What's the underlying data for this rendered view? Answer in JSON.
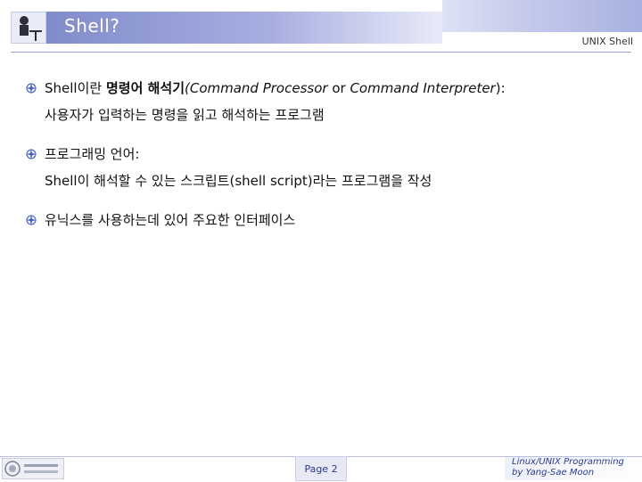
{
  "slide": {
    "title": "Shell?",
    "header_label": "UNIX Shell"
  },
  "bullets": [
    {
      "line1_a": "Shell이란 ",
      "line1_b": "명령어 해석기",
      "line1_c": "(Command Processor ",
      "line1_d": "or ",
      "line1_e": "Command Interpreter",
      "line1_f": "):",
      "line2": "사용자가 입력하는 명령을 읽고 해석하는 프로그램"
    },
    {
      "line1": "프로그래밍 언어:",
      "line2": "Shell이 해석할 수 있는 스크립트(shell script)라는 프로그램을 작성"
    },
    {
      "line1": "유닉스를 사용하는데 있어 주요한 인터페이스"
    }
  ],
  "footer": {
    "page": "Page 2",
    "right_line1": "Linux/UNIX Programming",
    "right_line2": "by Yang-Sae Moon"
  }
}
